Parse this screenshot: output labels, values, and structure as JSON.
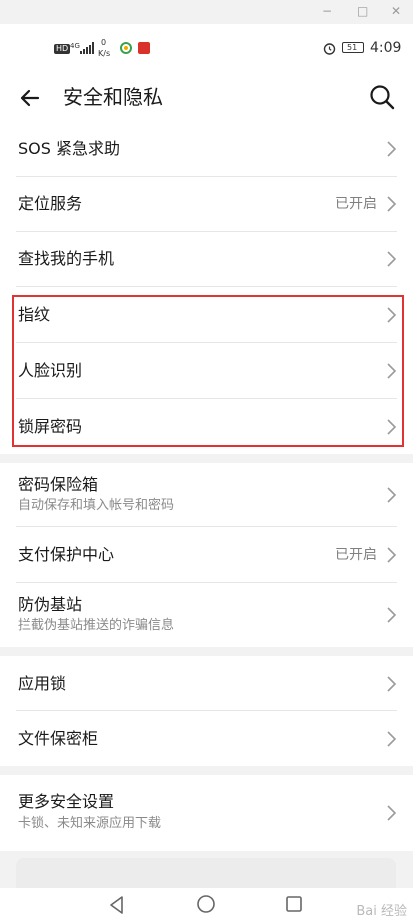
{
  "window_controls": [
    "−",
    "□",
    "✕"
  ],
  "status_bar": {
    "hd": "HD",
    "net_type": "4G",
    "speed_value": "0",
    "speed_unit": "K/s",
    "battery": "51",
    "time": "4:09"
  },
  "app_bar": {
    "title": "安全和隐私",
    "back_icon": "arrow-left-icon",
    "search_icon": "search-icon"
  },
  "settings": {
    "groups": [
      {
        "items": [
          {
            "label": "SOS 紧急求助",
            "value": "",
            "subtitle": ""
          },
          {
            "label": "定位服务",
            "value": "已开启",
            "subtitle": ""
          },
          {
            "label": "查找我的手机",
            "value": "",
            "subtitle": ""
          },
          {
            "label": "指纹",
            "value": "",
            "subtitle": ""
          },
          {
            "label": "人脸识别",
            "value": "",
            "subtitle": ""
          },
          {
            "label": "锁屏密码",
            "value": "",
            "subtitle": ""
          }
        ]
      },
      {
        "items": [
          {
            "label": "密码保险箱",
            "value": "",
            "subtitle": "自动保存和填入帐号和密码"
          },
          {
            "label": "支付保护中心",
            "value": "已开启",
            "subtitle": ""
          },
          {
            "label": "防伪基站",
            "value": "",
            "subtitle": "拦截伪基站推送的诈骗信息"
          }
        ]
      },
      {
        "items": [
          {
            "label": "应用锁",
            "value": "",
            "subtitle": ""
          },
          {
            "label": "文件保密柜",
            "value": "",
            "subtitle": ""
          }
        ]
      },
      {
        "items": [
          {
            "label": "更多安全设置",
            "value": "",
            "subtitle": "卡锁、未知来源应用下载"
          }
        ]
      }
    ]
  },
  "watermark": "Bai 经验",
  "colors": {
    "highlight_box": "#e23333",
    "background": "#f2f2f2",
    "secondary_text": "#808080"
  }
}
